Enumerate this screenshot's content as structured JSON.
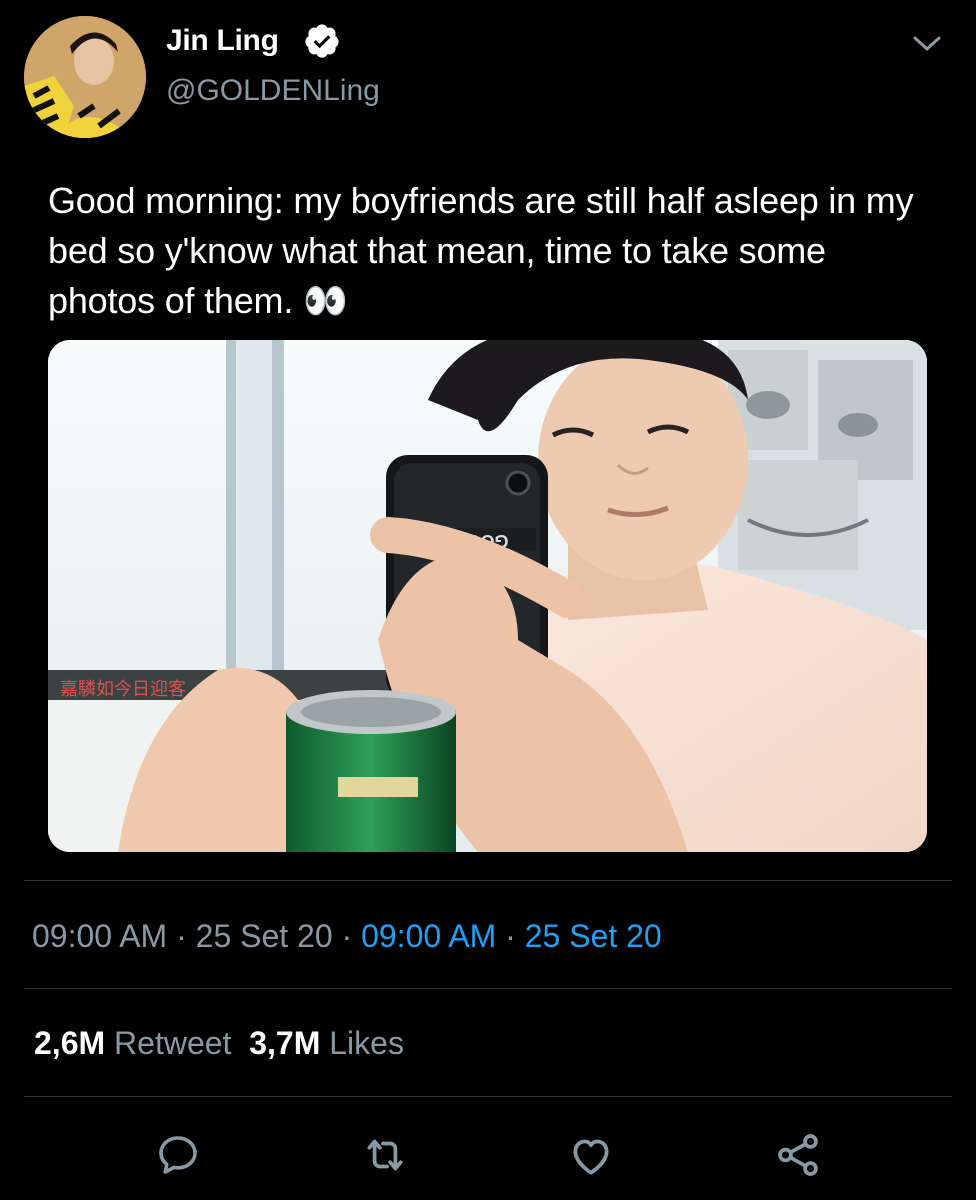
{
  "user": {
    "display_name": "Jin Ling",
    "handle": "@GOLDENLing",
    "verified": true,
    "avatar_icon": "avatar"
  },
  "tweet": {
    "text": "Good morning: my boyfriends are still half asleep in my bed so y'know what that mean, time to take some photos of them. 👀",
    "image_text": "GOOD",
    "image_watermark": "嘉驎如今日迎客"
  },
  "meta": {
    "time": "09:00 AM",
    "date": "25 Set 20",
    "time_link": "09:00 AM",
    "date_link": "25 Set 20",
    "separator": " · "
  },
  "stats": {
    "retweets_count": "2,6M",
    "retweets_label": "Retweet",
    "likes_count": "3,7M",
    "likes_label": "Likes"
  },
  "actions": {
    "reply_icon": "reply-icon",
    "retweet_icon": "retweet-icon",
    "like_icon": "heart-icon",
    "share_icon": "share-icon"
  },
  "colors": {
    "background": "#000000",
    "text": "#ffffff",
    "muted": "#8899a6",
    "link": "#1da1f2",
    "divider": "#2f3336"
  }
}
